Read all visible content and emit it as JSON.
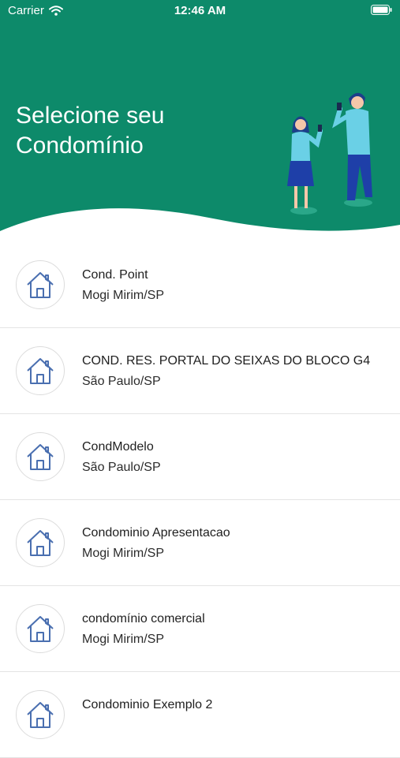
{
  "status_bar": {
    "carrier": "Carrier",
    "time": "12:46 AM"
  },
  "header": {
    "title_line1": "Selecione seu",
    "title_line2": "Condomínio"
  },
  "colors": {
    "header_bg": "#0d8a6a",
    "icon": "#4a6fb0"
  },
  "condominios": [
    {
      "name": "Cond. Point",
      "city": "Mogi Mirim/SP",
      "icon": "house-icon"
    },
    {
      "name": "COND. RES. PORTAL DO SEIXAS DO BLOCO G4",
      "city": "São Paulo/SP",
      "icon": "house-icon"
    },
    {
      "name": "CondModelo",
      "city": "São Paulo/SP",
      "icon": "house-icon"
    },
    {
      "name": "Condominio Apresentacao",
      "city": "Mogi Mirim/SP",
      "icon": "house-icon"
    },
    {
      "name": "condomínio comercial",
      "city": "Mogi Mirim/SP",
      "icon": "house-icon"
    },
    {
      "name": "Condominio Exemplo 2",
      "city": "",
      "icon": "house-icon"
    }
  ]
}
